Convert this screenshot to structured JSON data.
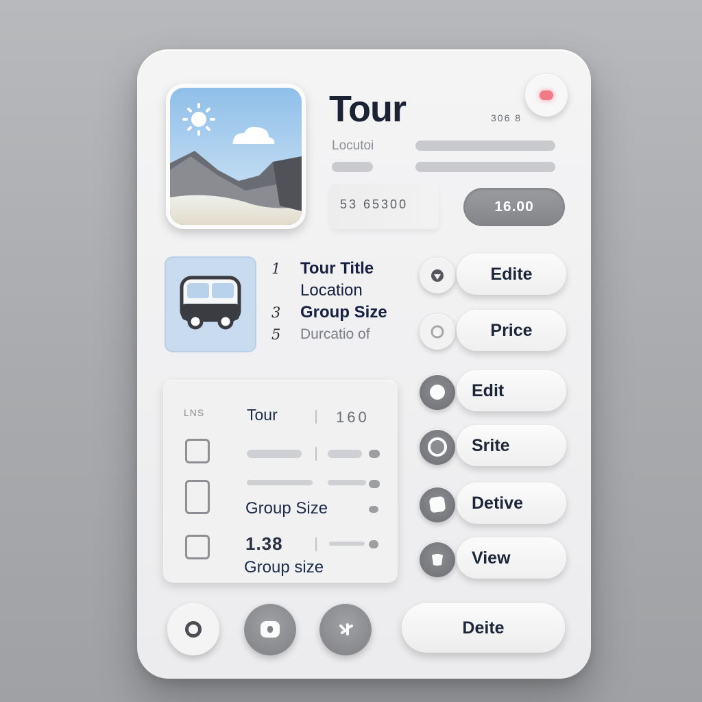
{
  "header": {
    "title": "Tour",
    "meta": "306 8",
    "location_label": "Locutoi",
    "code": "53 65300",
    "price": "16.00"
  },
  "info_list": [
    {
      "num": "1",
      "text": "Tour Title"
    },
    {
      "num": "",
      "text": "Location"
    },
    {
      "num": "3",
      "text": "Group Size"
    },
    {
      "num": "5",
      "text": "Durcatio of"
    }
  ],
  "actions": [
    {
      "label": "Edite",
      "icon": "shield-icon"
    },
    {
      "label": "Price",
      "icon": "tag-icon"
    },
    {
      "label": "Edit",
      "icon": "dot-icon"
    },
    {
      "label": "Srite",
      "icon": "ring-icon"
    },
    {
      "label": "Detive",
      "icon": "square-icon"
    },
    {
      "label": "View",
      "icon": "badge-icon"
    }
  ],
  "table": {
    "header_icon": "LNS",
    "row1_label": "Tour",
    "row1_value": "160",
    "row3_label": "Group Size",
    "row4_value": "1.38",
    "row4_label": "Group size"
  },
  "bottom": {
    "delete_label": "Deite",
    "icons": [
      "settings-icon",
      "lock-icon",
      "share-icon"
    ]
  },
  "colors": {
    "accent_dark": "#162040",
    "close_dot": "#f07b85",
    "bus_panel": "#c9dcef"
  }
}
